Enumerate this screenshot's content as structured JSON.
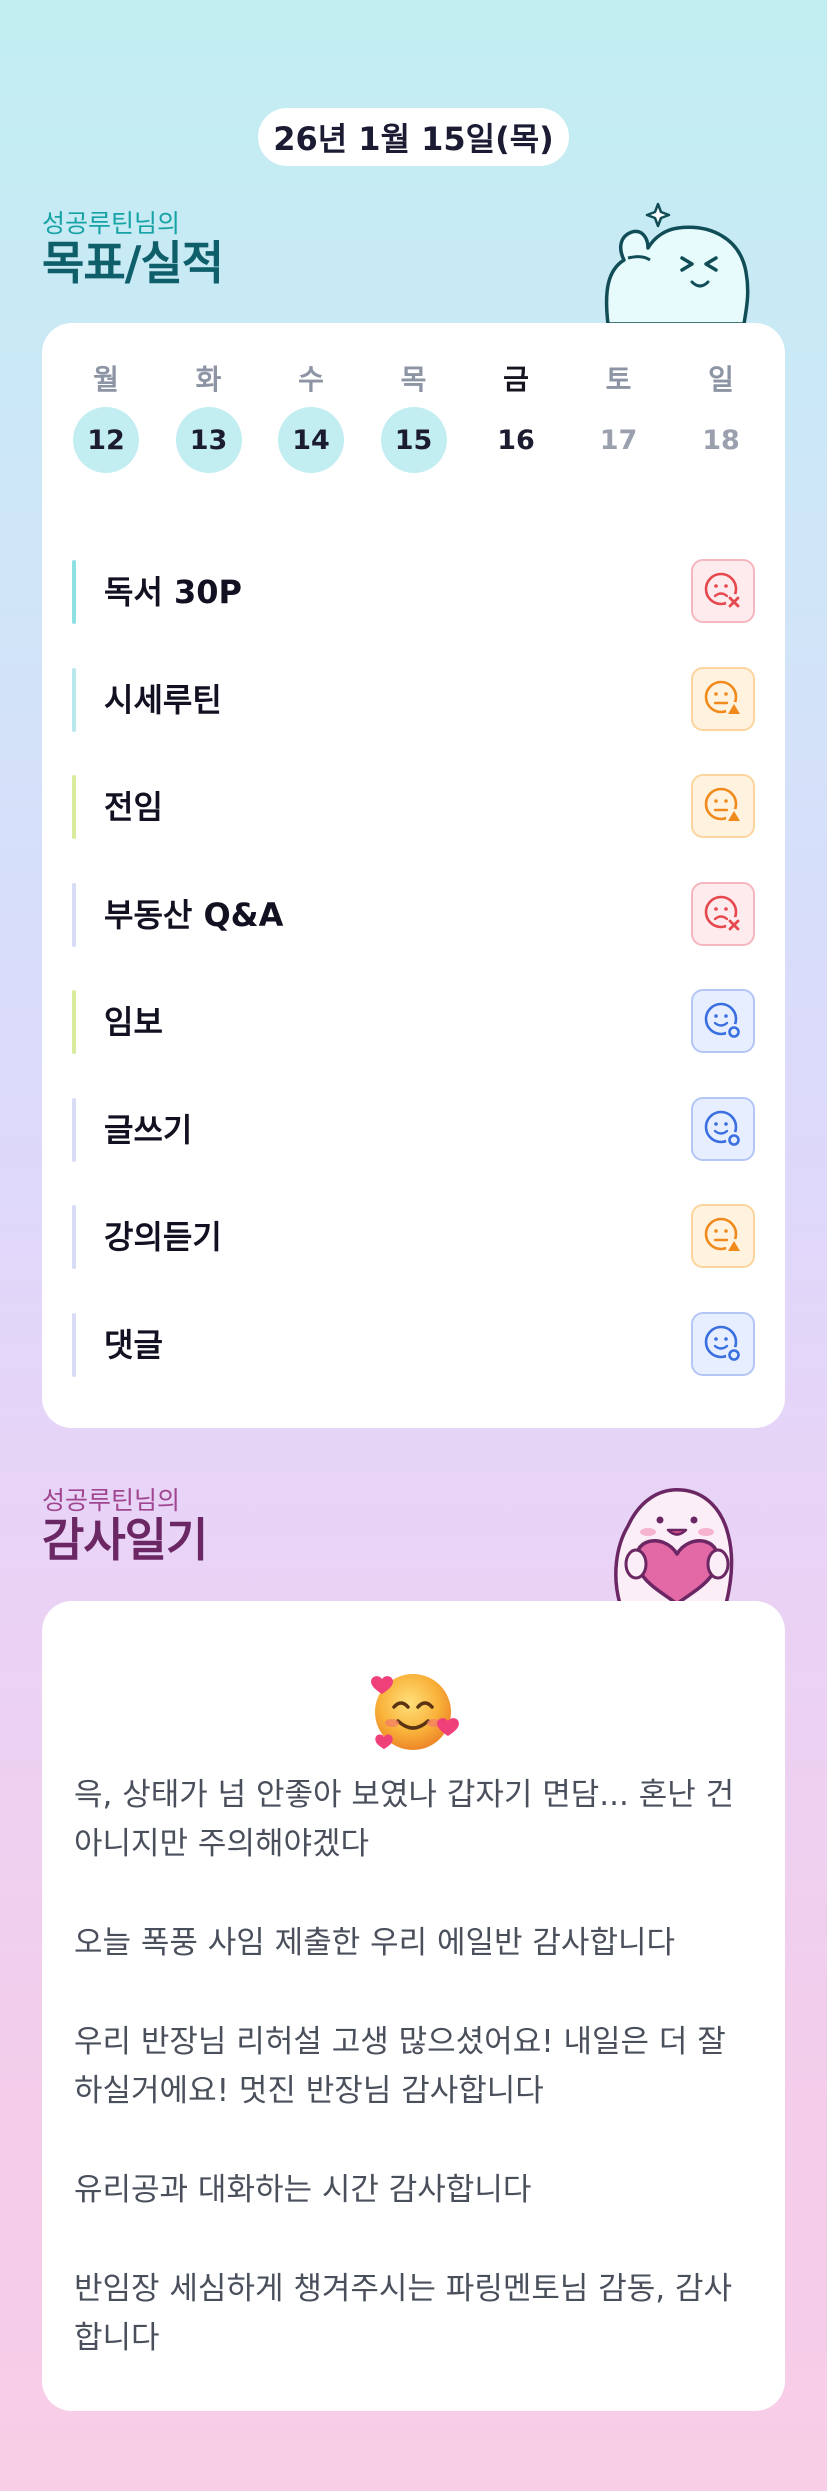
{
  "header": {
    "date": "26년 1월 15일(목)"
  },
  "goals_section": {
    "subtitle": "성공루틴님의",
    "title": "목표/실적",
    "week": [
      {
        "day": "월",
        "date": "12",
        "state": "done"
      },
      {
        "day": "화",
        "date": "13",
        "state": "done"
      },
      {
        "day": "수",
        "date": "14",
        "state": "done"
      },
      {
        "day": "목",
        "date": "15",
        "state": "done"
      },
      {
        "day": "금",
        "date": "16",
        "state": "today"
      },
      {
        "day": "토",
        "date": "17",
        "state": "future"
      },
      {
        "day": "일",
        "date": "18",
        "state": "future"
      }
    ],
    "items": [
      {
        "label": "독서 30P",
        "status": "x",
        "bar_color": "#8fe0e2"
      },
      {
        "label": "시세루틴",
        "status": "triangle",
        "bar_color": "#b9e8ec"
      },
      {
        "label": "전임",
        "status": "triangle",
        "bar_color": "#d8ec9c"
      },
      {
        "label": "부동산 Q&A",
        "status": "x",
        "bar_color": "#d8dcf4"
      },
      {
        "label": "임보",
        "status": "circle",
        "bar_color": "#d8ec9c"
      },
      {
        "label": "글쓰기",
        "status": "circle",
        "bar_color": "#d8dcf4"
      },
      {
        "label": "강의듣기",
        "status": "triangle",
        "bar_color": "#d8dcf4"
      },
      {
        "label": "댓글",
        "status": "circle",
        "bar_color": "#d8dcf4"
      }
    ]
  },
  "gratitude_section": {
    "subtitle": "성공루틴님의",
    "title": "감사일기",
    "emoji": "smiling-face-with-hearts",
    "entries": [
      "윽, 상태가 넘 안좋아 보였나 갑자기 면담... 혼난 건 아니지만 주의해야겠다",
      "오늘 폭풍 사임 제출한 우리 에일반 감사합니다",
      "우리 반장님 리허설 고생 많으셨어요! 내일은 더 잘하실거에요! 멋진 반장님 감사합니다",
      "유리공과 대화하는 시간 감사합니다",
      "반임장 세심하게 챙겨주시는 파링멘토님 감동, 감사합니다"
    ]
  },
  "colors": {
    "status_x": "#e5484d",
    "status_triangle": "#f08a1c",
    "status_circle": "#3a6fe0",
    "done_day_bg": "#c3eef1"
  }
}
